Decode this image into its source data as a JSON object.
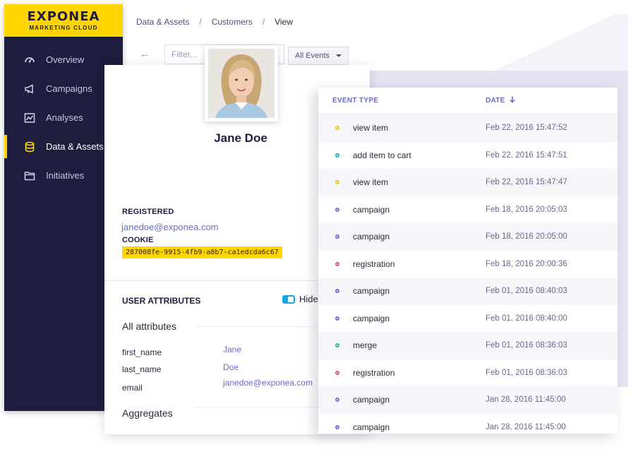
{
  "brand": {
    "name": "EXPONEA",
    "subtitle": "MARKETING CLOUD"
  },
  "sidebar": {
    "items": [
      {
        "label": "Overview",
        "icon": "gauge-icon",
        "active": false
      },
      {
        "label": "Campaigns",
        "icon": "megaphone-icon",
        "active": false
      },
      {
        "label": "Analyses",
        "icon": "chart-icon",
        "active": false
      },
      {
        "label": "Data & Assets",
        "icon": "database-icon",
        "active": true
      },
      {
        "label": "Initiatives",
        "icon": "folder-icon",
        "active": false
      }
    ],
    "accent": "#ffd500",
    "background": "#1f1d3d"
  },
  "breadcrumb": {
    "items": [
      "Data & Assets",
      "Customers",
      "View"
    ],
    "separator": "/"
  },
  "toolbar": {
    "filter_placeholder": "Filter...",
    "events_select": "All Events"
  },
  "profile": {
    "name": "Jane Doe",
    "registered_label": "REGISTERED",
    "registered_value": "janedoe@exponea.com",
    "cookie_label": "COOKIE",
    "cookie_value": "287008fe-9915-4fb9-a8b7-ca1edcda6c67",
    "user_attributes_label": "USER ATTRIBUTES",
    "hide_toggle_label": "Hide",
    "all_attributes_title": "All attributes",
    "attributes": [
      {
        "key": "first_name",
        "value": "Jane"
      },
      {
        "key": "last_name",
        "value": "Doe"
      },
      {
        "key": "email",
        "value": "janedoe@exponea.com"
      }
    ],
    "aggregates_title": "Aggregates"
  },
  "events": {
    "col_type": "EVENT TYPE",
    "col_date": "DATE",
    "rows": [
      {
        "type": "view item",
        "date": "Feb 22, 2016 15:47:52",
        "color": "#f5c518"
      },
      {
        "type": "add item to cart",
        "date": "Feb 22, 2016 15:47:51",
        "color": "#1fb5c8"
      },
      {
        "type": "view item",
        "date": "Feb 22, 2016 15:47:47",
        "color": "#f5c518"
      },
      {
        "type": "campaign",
        "date": "Feb 18, 2016 20:05:03",
        "color": "#7b6ad8"
      },
      {
        "type": "campaign",
        "date": "Feb 18, 2016 20:05:00",
        "color": "#7b6ad8"
      },
      {
        "type": "registration",
        "date": "Feb 18, 2016 20:00:36",
        "color": "#e0509a"
      },
      {
        "type": "campaign",
        "date": "Feb 01, 2016 08:40:03",
        "color": "#7b6ad8"
      },
      {
        "type": "campaign",
        "date": "Feb 01, 2016 08:40:00",
        "color": "#7b6ad8"
      },
      {
        "type": "merge",
        "date": "Feb 01, 2016 08:36:03",
        "color": "#2fb89a"
      },
      {
        "type": "registration",
        "date": "Feb 01, 2016 08:36:03",
        "color": "#e0509a"
      },
      {
        "type": "campaign",
        "date": "Jan 28, 2016 11:45:00",
        "color": "#7b6ad8"
      },
      {
        "type": "campaign",
        "date": "Jan 28, 2016 11:45:00",
        "color": "#7b6ad8"
      }
    ]
  }
}
